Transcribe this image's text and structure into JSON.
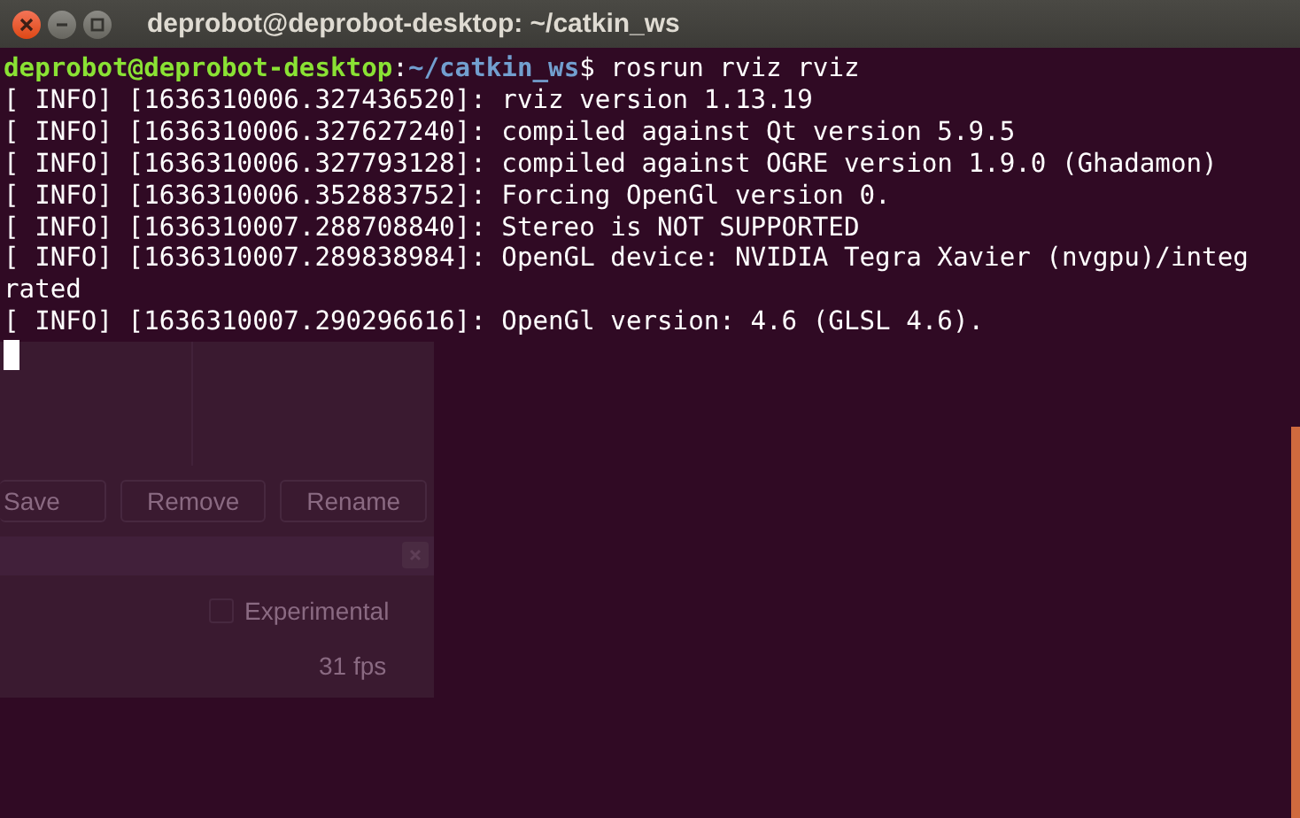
{
  "window": {
    "title": "deprobot@deprobot-desktop: ~/catkin_ws"
  },
  "prompt": {
    "user_host": "deprobot@deprobot-desktop",
    "separator": ":",
    "path": "~/catkin_ws",
    "command": "$ rosrun rviz rviz"
  },
  "output_lines": [
    "[ INFO] [1636310006.327436520]: rviz version 1.13.19",
    "[ INFO] [1636310006.327627240]: compiled against Qt version 5.9.5",
    "[ INFO] [1636310006.327793128]: compiled against OGRE version 1.9.0 (Ghadamon)",
    "[ INFO] [1636310006.352883752]: Forcing OpenGl version 0.",
    "[ INFO] [1636310007.288708840]: Stereo is NOT SUPPORTED",
    "[ INFO] [1636310007.289838984]: OpenGL device: NVIDIA Tegra Xavier (nvgpu)/integ",
    "rated",
    "[ INFO] [1636310007.290296616]: OpenGl version: 4.6 (GLSL 4.6)."
  ],
  "background_window": {
    "buttons": [
      "Save",
      "Remove",
      "Rename"
    ],
    "experimental": {
      "label": "Experimental",
      "checked": false
    },
    "fps": "31 fps"
  }
}
